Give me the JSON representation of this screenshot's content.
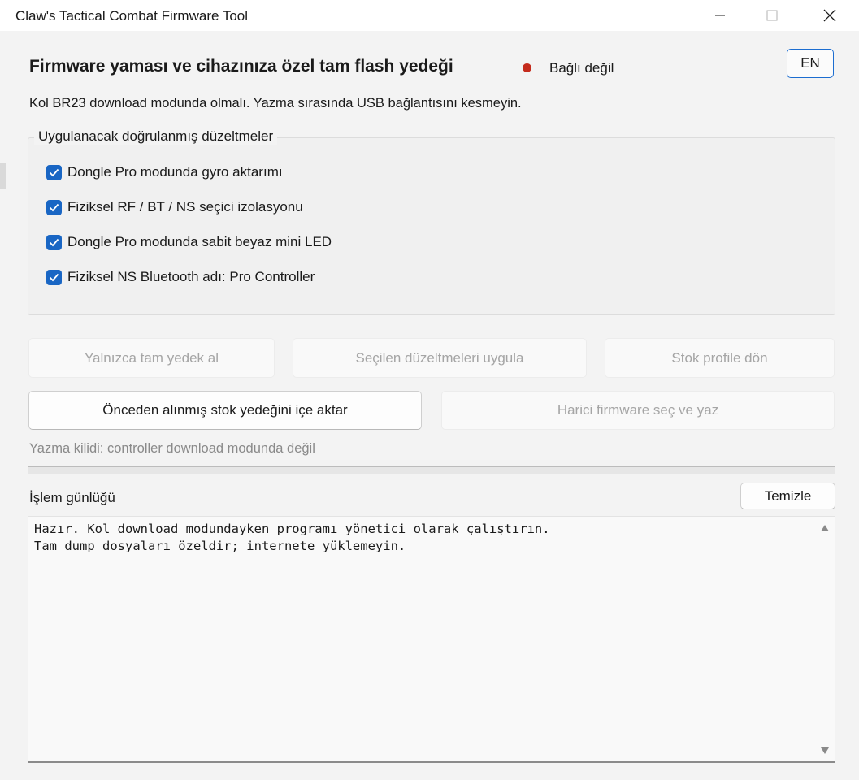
{
  "window": {
    "title": "Claw's Tactical Combat Firmware Tool"
  },
  "header": {
    "heading": "Firmware yaması ve cihazınıza özel tam flash yedeği",
    "connection_status": "Bağlı değil",
    "status_color": "#c42b1c",
    "language_button": "EN",
    "instructions": "Kol BR23 download modunda olmalı. Yazma sırasında USB bağlantısını kesmeyin."
  },
  "fixes": {
    "legend": "Uygulanacak doğrulanmış düzeltmeler",
    "items": [
      {
        "label": "Dongle Pro modunda gyro aktarımı",
        "checked": true
      },
      {
        "label": "Fiziksel RF / BT / NS seçici izolasyonu",
        "checked": true
      },
      {
        "label": "Dongle Pro modunda sabit beyaz mini LED",
        "checked": true
      },
      {
        "label": "Fiziksel NS Bluetooth adı: Pro Controller",
        "checked": true
      }
    ]
  },
  "actions": {
    "backup_only": "Yalnızca tam yedek al",
    "apply_fixes": "Seçilen düzeltmeleri uygula",
    "restore_stock": "Stok profile dön",
    "import_backup": "Önceden alınmış stok yedeğini içe aktar",
    "external_firmware": "Harici firmware seç ve yaz"
  },
  "lock_status": "Yazma kilidi: controller download modunda değil",
  "progress": {
    "value": 0
  },
  "log": {
    "label": "İşlem günlüğü",
    "clear_button": "Temizle",
    "lines": [
      "Hazır. Kol download modundayken programı yönetici olarak çalıştırın.",
      "Tam dump dosyaları özeldir; internete yüklemeyin."
    ]
  },
  "colors": {
    "accent": "#1966c4",
    "check_accent": "#1966c4",
    "disabled_text": "#a5a5a5"
  }
}
